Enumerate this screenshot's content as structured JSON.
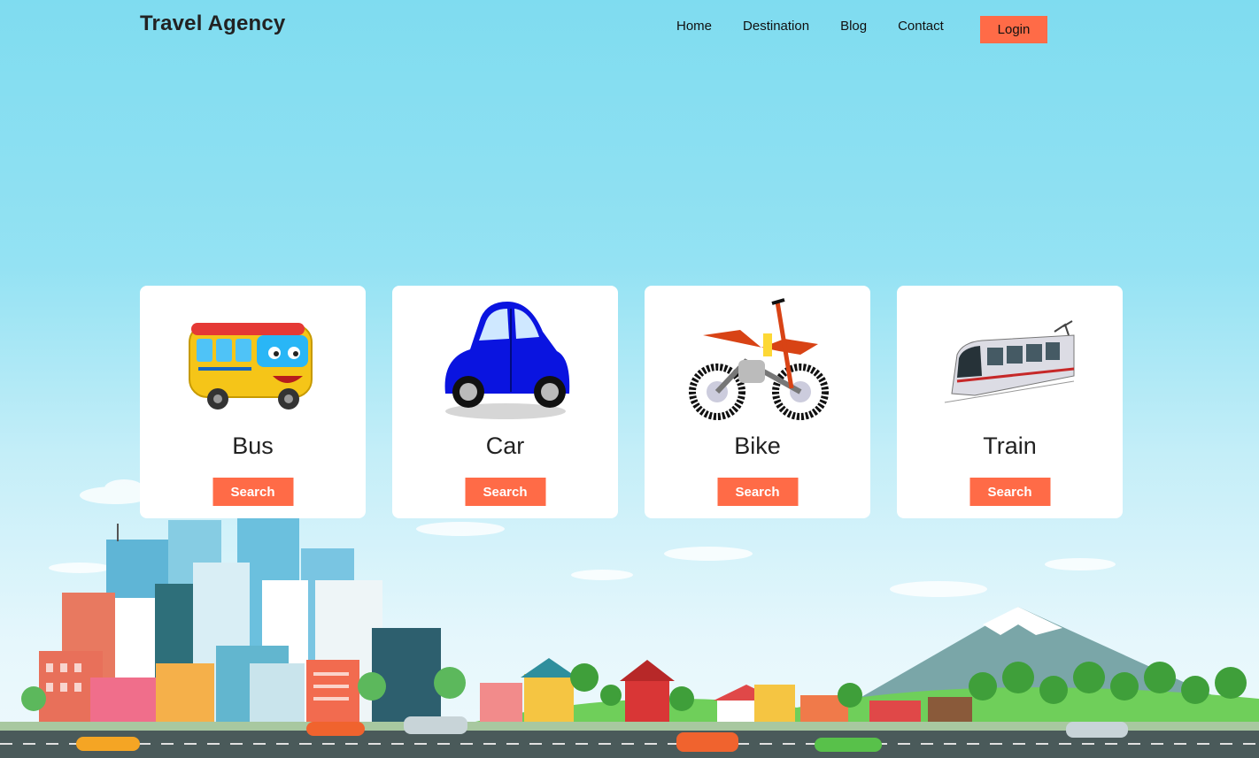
{
  "header": {
    "brand": "Travel Agency",
    "nav": [
      "Home",
      "Destination",
      "Blog",
      "Contact"
    ],
    "login_label": "Login"
  },
  "cards": [
    {
      "title": "Bus",
      "button": "Search",
      "icon": "bus-icon"
    },
    {
      "title": "Car",
      "button": "Search",
      "icon": "car-icon"
    },
    {
      "title": "Bike",
      "button": "Search",
      "icon": "bike-icon"
    },
    {
      "title": "Train",
      "button": "Search",
      "icon": "train-icon"
    }
  ],
  "colors": {
    "accent": "#ff6b47",
    "sky_top": "#7fdcf0",
    "card_bg": "#ffffff",
    "road": "#4a5a5a"
  }
}
